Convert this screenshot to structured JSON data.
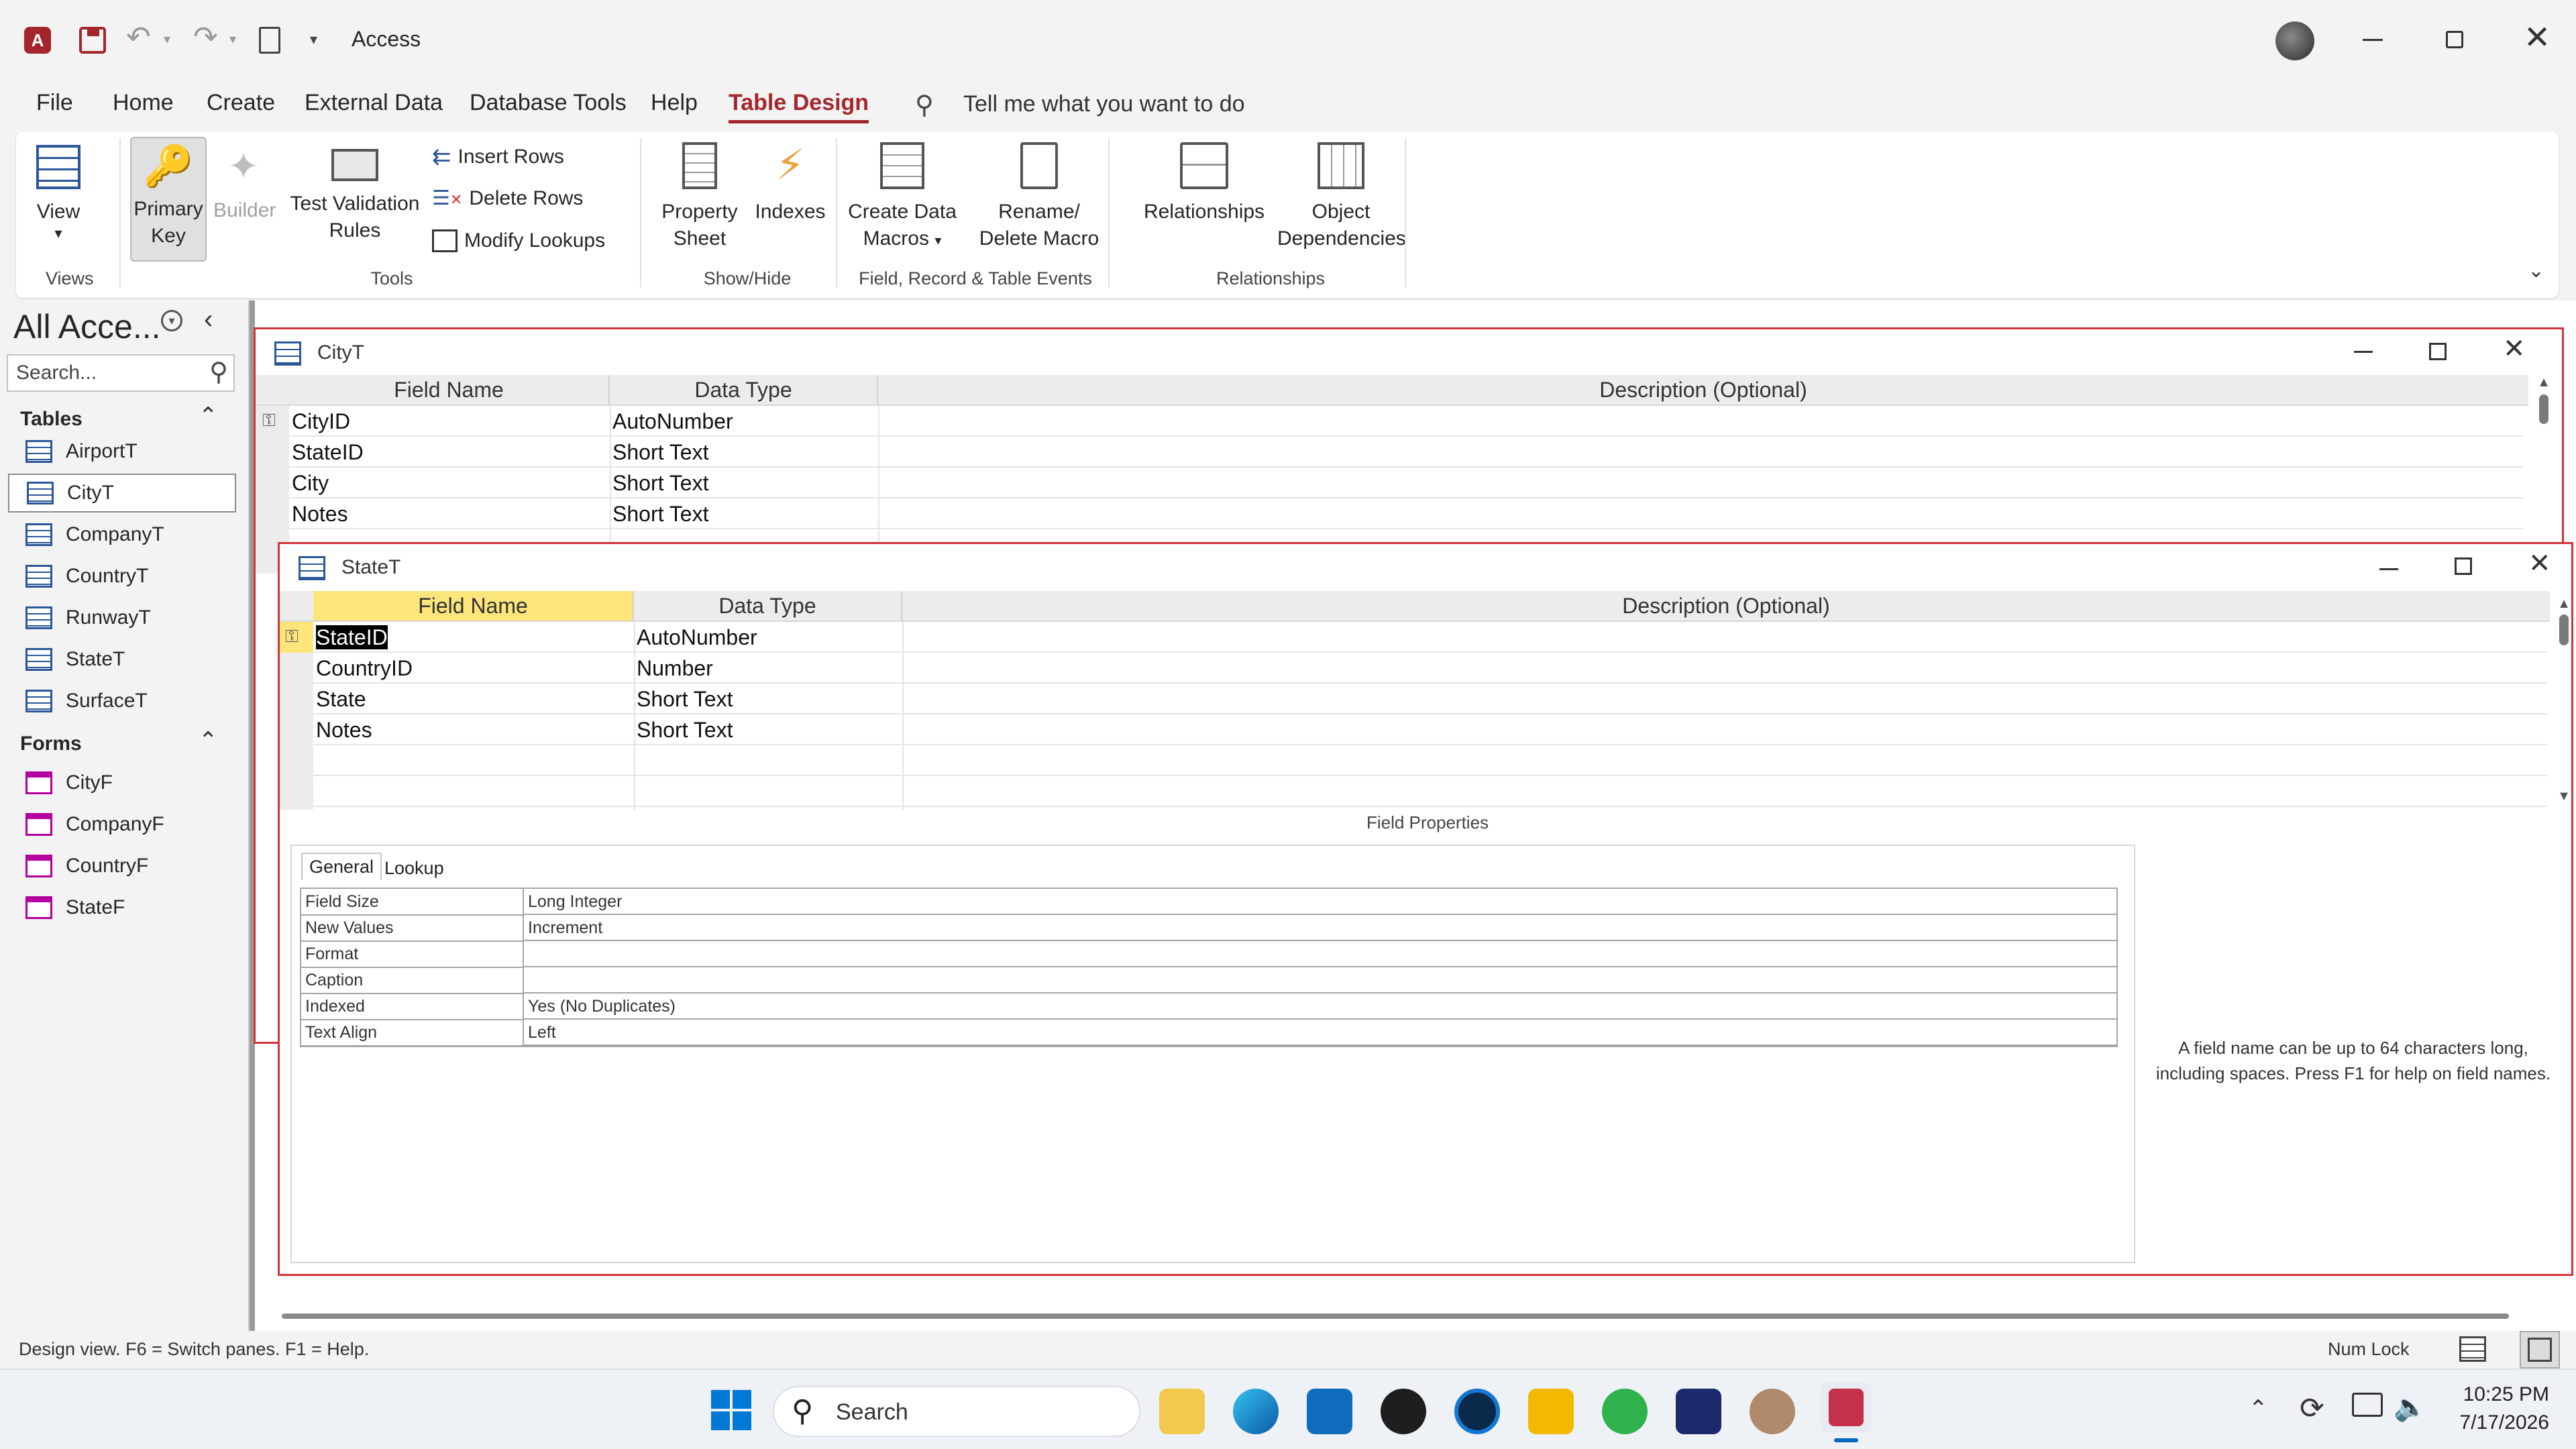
{
  "titlebar": {
    "app_title": "Access"
  },
  "tabs": [
    "File",
    "Home",
    "Create",
    "External Data",
    "Database Tools",
    "Help",
    "Table Design"
  ],
  "tell_me": "Tell me what you want to do",
  "ribbon": {
    "view": "View",
    "primary_key_1": "Primary",
    "primary_key_2": "Key",
    "builder": "Builder",
    "test_validation_1": "Test Validation",
    "test_validation_2": "Rules",
    "insert_rows": "Insert Rows",
    "delete_rows": "Delete Rows",
    "modify_lookups": "Modify Lookups",
    "property_sheet_1": "Property",
    "property_sheet_2": "Sheet",
    "indexes": "Indexes",
    "create_data_macros_1": "Create Data",
    "create_data_macros_2": "Macros",
    "rename_delete_macro_1": "Rename/",
    "rename_delete_macro_2": "Delete Macro",
    "relationships": "Relationships",
    "object_dependencies_1": "Object",
    "object_dependencies_2": "Dependencies",
    "groups": {
      "views": "Views",
      "tools": "Tools",
      "show_hide": "Show/Hide",
      "events": "Field, Record & Table Events",
      "relationships": "Relationships"
    }
  },
  "nav": {
    "title": "All Acce...",
    "search_placeholder": "Search...",
    "tables_header": "Tables",
    "tables": [
      "AirportT",
      "CityT",
      "CompanyT",
      "CountryT",
      "RunwayT",
      "StateT",
      "SurfaceT"
    ],
    "forms_header": "Forms",
    "forms": [
      "CityF",
      "CompanyF",
      "CountryF",
      "StateF"
    ]
  },
  "city_window": {
    "title": "CityT",
    "headers": [
      "Field Name",
      "Data Type",
      "Description (Optional)"
    ],
    "rows": [
      {
        "field": "CityID",
        "type": "AutoNumber"
      },
      {
        "field": "StateID",
        "type": "Short Text"
      },
      {
        "field": "City",
        "type": "Short Text"
      },
      {
        "field": "Notes",
        "type": "Short Text"
      }
    ]
  },
  "state_window": {
    "title": "StateT",
    "headers": [
      "Field Name",
      "Data Type",
      "Description (Optional)"
    ],
    "rows": [
      {
        "field": "StateID",
        "type": "AutoNumber"
      },
      {
        "field": "CountryID",
        "type": "Number"
      },
      {
        "field": "State",
        "type": "Short Text"
      },
      {
        "field": "Notes",
        "type": "Short Text"
      }
    ],
    "field_properties_label": "Field Properties",
    "prop_tabs": [
      "General",
      "Lookup"
    ],
    "properties": [
      {
        "name": "Field Size",
        "value": "Long Integer"
      },
      {
        "name": "New Values",
        "value": "Increment"
      },
      {
        "name": "Format",
        "value": ""
      },
      {
        "name": "Caption",
        "value": ""
      },
      {
        "name": "Indexed",
        "value": "Yes (No Duplicates)"
      },
      {
        "name": "Text Align",
        "value": "Left"
      }
    ],
    "help_line1": "A field name can be up to 64 characters long,",
    "help_line2": "including spaces. Press F1 for help on field names."
  },
  "status": {
    "text": "Design view.  F6 = Switch panes.  F1 = Help.",
    "num_lock": "Num Lock"
  },
  "taskbar": {
    "search": "Search",
    "time": "10:25 PM",
    "date": "7/17/2026"
  },
  "colors": {
    "accent": "#a4262c",
    "window_border": "#d13438",
    "selected_header": "#fde47b"
  }
}
